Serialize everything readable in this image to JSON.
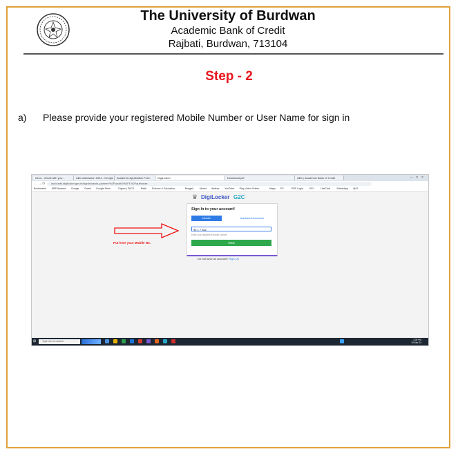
{
  "header": {
    "institution": "The University of Burdwan",
    "department": "Academic Bank of Credit",
    "address": "Rajbati, Burdwan, 713104",
    "seal_icon": "university-seal-icon"
  },
  "step_title": "Step - 2",
  "instruction": {
    "marker": "a)",
    "text": "Please provide your registered Mobile Number or User Name for sign in"
  },
  "screenshot": {
    "tabs": [
      "Inbox - Email with you...",
      "ABC Admission 2024 - Google",
      "Academic Application Form",
      "DigiLocker",
      "Download pdf",
      "ABC | Academic Bank of Credit"
    ],
    "active_tab_index": 3,
    "address_url": "accounts.digilocker.gov.in/signin/oauth_partner/%2Foauth2%2F1%2Fauthorize",
    "bookmarks": [
      "Bookmarks",
      "ABP Ananda",
      "Google",
      "Gmail",
      "Google Drive",
      "Digum | FACE",
      "Math",
      "Science & Education",
      "Bengali",
      "Model",
      "Aadhar",
      "YouTube",
      "Play Video Online",
      "Maps",
      "PC",
      "PDF Login",
      "UPI",
      "LiveChat",
      "WhatsApp",
      "AKS"
    ],
    "logo": {
      "word": "DigiLocker",
      "g2c": "G2C"
    },
    "card": {
      "heading": "Sign In to your account!",
      "tab_mobile": "Mobile",
      "tab_alt": "Aadhaar/Username",
      "input_value": "94 1 7 352",
      "hint": "Enter your registered Mobile number",
      "next_button": "Next"
    },
    "signup_prefix": "Do not have an account?",
    "signup_link": "Sign Up",
    "annotation": "Put here your Mobile No.",
    "taskbar": {
      "search_placeholder": "Type here to search",
      "time": "1:00 PM",
      "date": "10-Mar-24"
    }
  },
  "colors": {
    "border": "#e0a23a",
    "step": "#e8161f",
    "primary": "#2e7be6",
    "next": "#2ea84a",
    "arrow": "#e11"
  }
}
